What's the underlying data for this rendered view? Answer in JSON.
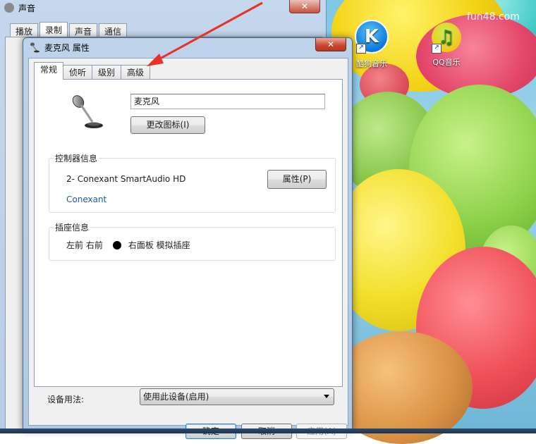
{
  "desktop": {
    "watermark": "fun48.com",
    "icons": [
      {
        "name": "酷狗音乐",
        "glyph": "K",
        "shortcut": "↗"
      },
      {
        "name": "QQ音乐",
        "glyph": "♫",
        "shortcut": "↗"
      }
    ]
  },
  "sound_window": {
    "title": "声音",
    "close_glyph": "✕",
    "tabs": [
      "播放",
      "录制",
      "声音",
      "通信"
    ],
    "active_tab": 1
  },
  "dialog": {
    "title": "麦克风 属性",
    "close_glyph": "✕",
    "tabs": [
      "常规",
      "侦听",
      "级别",
      "高级"
    ],
    "active_tab": 0,
    "device_name": "麦克风",
    "change_icon_label": "更改图标(I)",
    "controller_group_title": "控制器信息",
    "controller_name": "2- Conexant SmartAudio HD",
    "controller_vendor": "Conexant",
    "properties_label": "属性(P)",
    "jack_group_title": "插座信息",
    "jack_position": "左前 右前",
    "jack_location": "右面板 模拟插座",
    "usage_label": "设备用法:",
    "usage_value": "使用此设备(启用)",
    "ok_label": "确定",
    "cancel_label": "取消",
    "apply_label": "应用(A)"
  },
  "annotation": {
    "color": "#e8312b"
  }
}
